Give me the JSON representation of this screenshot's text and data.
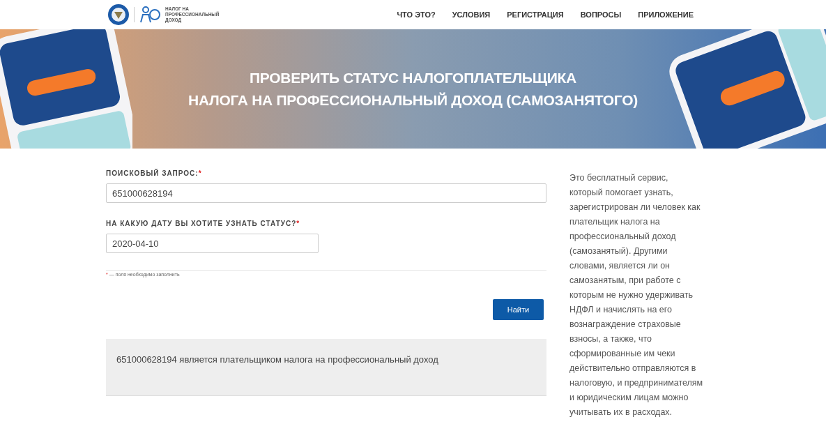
{
  "header": {
    "logo_text": "НАЛОГ НА ПРОФЕССИОНАЛЬНЫЙ ДОХОД",
    "nav": [
      {
        "label": "ЧТО ЭТО?"
      },
      {
        "label": "УСЛОВИЯ"
      },
      {
        "label": "РЕГИСТРАЦИЯ"
      },
      {
        "label": "ВОПРОСЫ"
      },
      {
        "label": "ПРИЛОЖЕНИЕ"
      }
    ]
  },
  "banner": {
    "title_lines": [
      "ПРОВЕРИТЬ СТАТУС НАЛОГОПЛАТЕЛЬЩИКА",
      "НАЛОГА НА ПРОФЕССИОНАЛЬНЫЙ ДОХОД (САМОЗАНЯТОГО)"
    ]
  },
  "form": {
    "fields": [
      {
        "label": "ПОИСКОВЫЙ ЗАПРОС:",
        "required_mark": "*",
        "value": "651000628194",
        "kind": "wide"
      },
      {
        "label": "НА КАКУЮ ДАТУ ВЫ ХОТИТЕ УЗНАТЬ СТАТУС?",
        "required_mark": "*",
        "value": "2020-04-10",
        "kind": "narrow"
      }
    ],
    "footnote": {
      "mark": "*",
      "text": "— поля необходимо заполнить"
    },
    "submit": "Найти"
  },
  "result": {
    "text": "651000628194 является плательщиком налога на профессиональный доход"
  },
  "sidebar": {
    "text": "Это бесплатный сервис, который помогает узнать, зарегистрирован ли человек как плательщик налога на профессиональный доход (самозанятый). Другими словами, является ли он самозанятым, при работе с которым не нужно удерживать НДФЛ и начислять на его вознаграждение страховые взносы, а также, что сформированные им чеки действительно отправляются в налоговую, и предпринимателям и юридическим лицам можно учитывать их в расходах."
  }
}
